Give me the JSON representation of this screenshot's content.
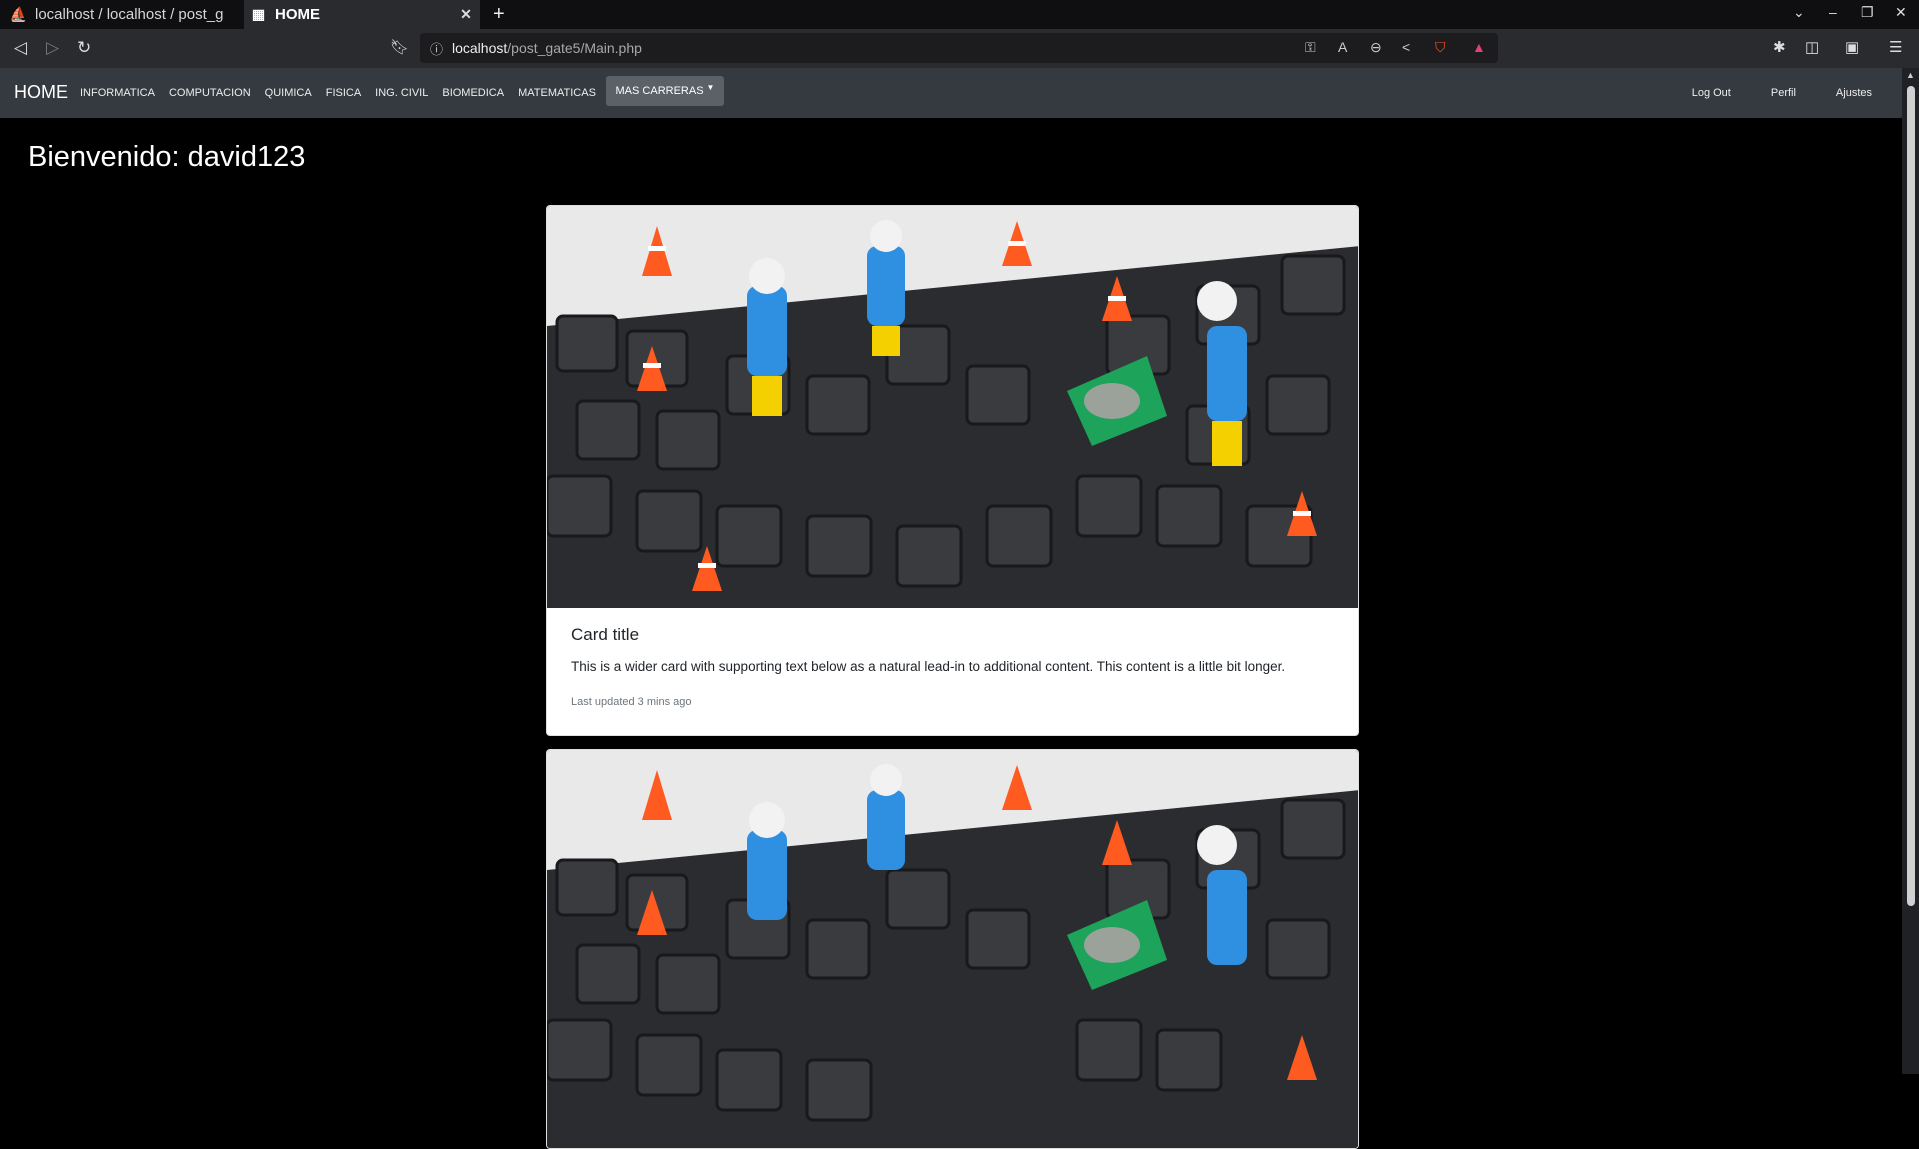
{
  "browser": {
    "tabs": [
      {
        "title": "localhost / localhost / post_g",
        "active": false
      },
      {
        "title": "HOME",
        "active": true
      }
    ],
    "url_host": "localhost",
    "url_path": "/post_gate5/Main.php"
  },
  "navbar": {
    "brand": "HOME",
    "links": [
      "INFORMATICA",
      "COMPUTACION",
      "QUIMICA",
      "FISICA",
      "ING. CIVIL",
      "BIOMEDICA",
      "MATEMATICAS"
    ],
    "dropdown_label": "MAS CARRERAS",
    "right_links": [
      "Log Out",
      "Perfil",
      "Ajustes"
    ]
  },
  "main": {
    "welcome": "Bienvenido: david123",
    "cards": [
      {
        "title": "Card title",
        "text": "This is a wider card with supporting text below as a natural lead-in to additional content. This content is a little bit longer.",
        "meta": "Last updated 3 mins ago"
      },
      {
        "title": "",
        "text": "",
        "meta": ""
      }
    ]
  },
  "colors": {
    "page_bg": "#000000",
    "navbar_bg": "#343a40",
    "dropdown_bg": "#5a6167",
    "card_bg": "#ffffff"
  }
}
